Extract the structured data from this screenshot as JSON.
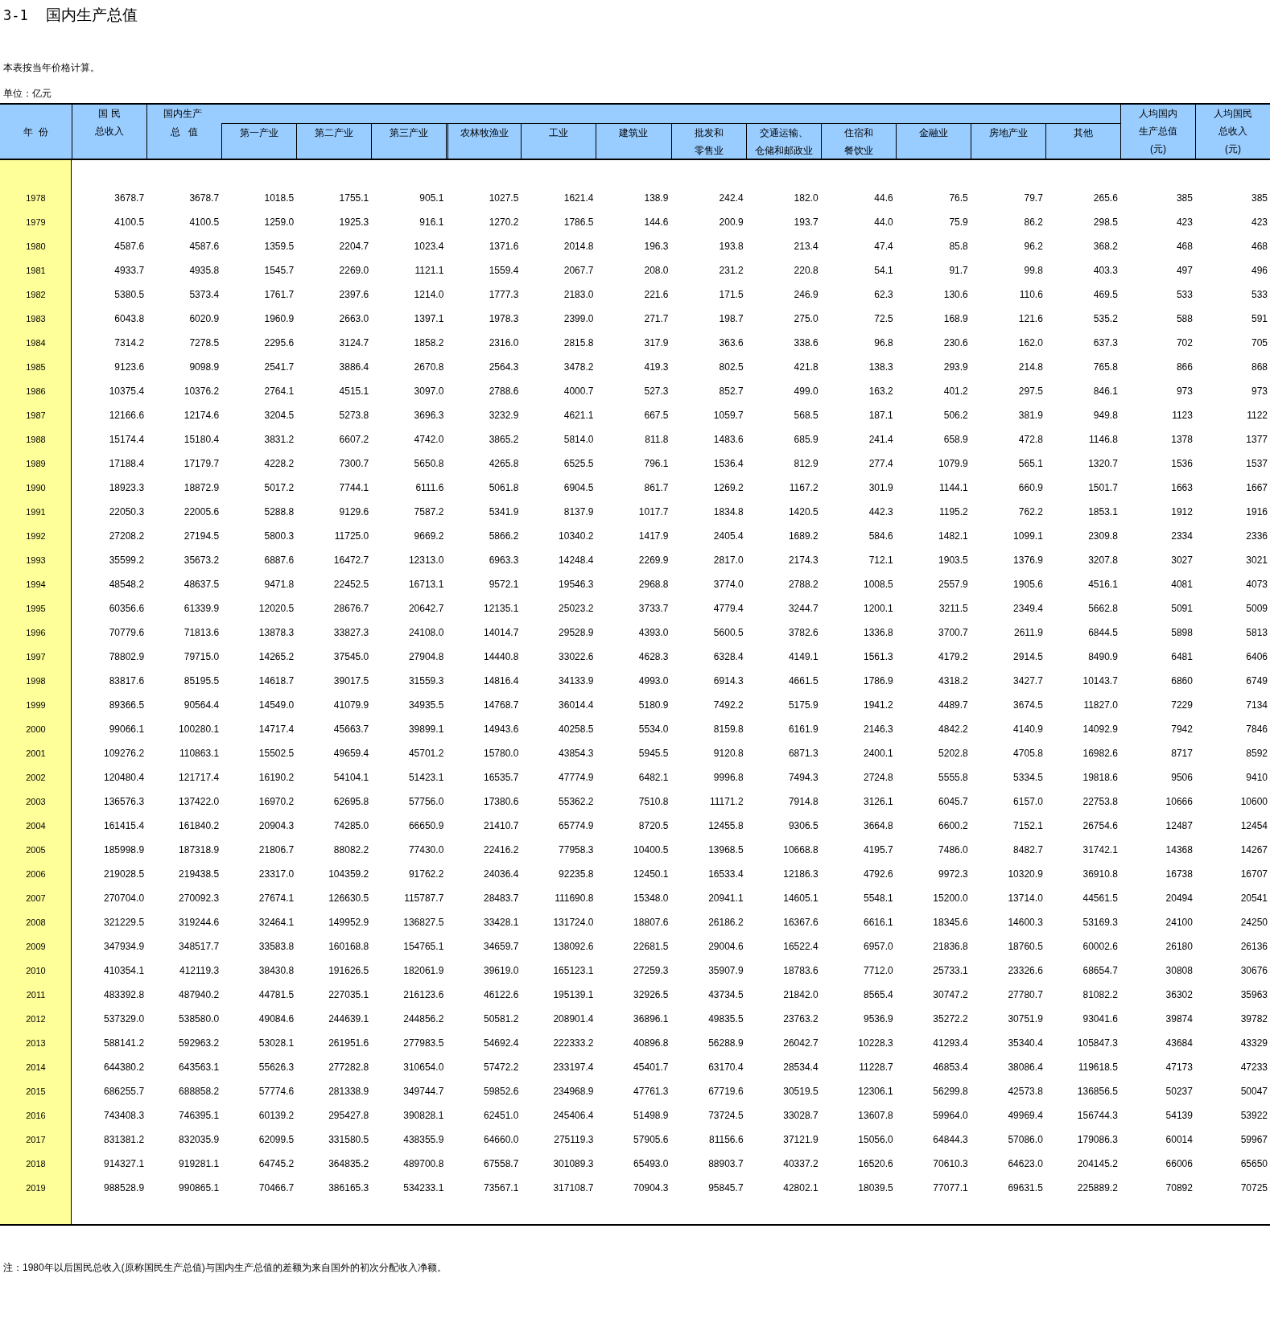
{
  "title": {
    "number": "3-1",
    "text": "国内生产总值"
  },
  "note": "本表按当年价格计算。",
  "unit": "单位：亿元",
  "header": {
    "year": "年  份",
    "gni": [
      "国 民",
      "总收入"
    ],
    "group": "国内生产",
    "gdp": "总   值",
    "subs": [
      [
        "第一产业"
      ],
      [
        "第二产业"
      ],
      [
        "第三产业"
      ],
      [
        "农林牧渔业"
      ],
      [
        "工业"
      ],
      [
        "建筑业"
      ],
      [
        "批发和",
        "零售业"
      ],
      [
        "交通运输、",
        "仓储和邮政业"
      ],
      [
        "住宿和",
        "餐饮业"
      ],
      [
        "金融业"
      ],
      [
        "房地产业"
      ],
      [
        "其他"
      ]
    ],
    "per_capita": [
      [
        "人均国内",
        "生产总值",
        "(元)"
      ],
      [
        "人均国民",
        "总收入",
        "(元)"
      ]
    ]
  },
  "rows": [
    {
      "year": "1978",
      "values": [
        "3678.7",
        "3678.7",
        "1018.5",
        "1755.1",
        "905.1",
        "1027.5",
        "1621.4",
        "138.9",
        "242.4",
        "182.0",
        "44.6",
        "76.5",
        "79.7",
        "265.6",
        "385",
        "385"
      ]
    },
    {
      "year": "1979",
      "values": [
        "4100.5",
        "4100.5",
        "1259.0",
        "1925.3",
        "916.1",
        "1270.2",
        "1786.5",
        "144.6",
        "200.9",
        "193.7",
        "44.0",
        "75.9",
        "86.2",
        "298.5",
        "423",
        "423"
      ]
    },
    {
      "year": "1980",
      "values": [
        "4587.6",
        "4587.6",
        "1359.5",
        "2204.7",
        "1023.4",
        "1371.6",
        "2014.8",
        "196.3",
        "193.8",
        "213.4",
        "47.4",
        "85.8",
        "96.2",
        "368.2",
        "468",
        "468"
      ]
    },
    {
      "year": "1981",
      "values": [
        "4933.7",
        "4935.8",
        "1545.7",
        "2269.0",
        "1121.1",
        "1559.4",
        "2067.7",
        "208.0",
        "231.2",
        "220.8",
        "54.1",
        "91.7",
        "99.8",
        "403.3",
        "497",
        "496"
      ]
    },
    {
      "year": "1982",
      "values": [
        "5380.5",
        "5373.4",
        "1761.7",
        "2397.6",
        "1214.0",
        "1777.3",
        "2183.0",
        "221.6",
        "171.5",
        "246.9",
        "62.3",
        "130.6",
        "110.6",
        "469.5",
        "533",
        "533"
      ]
    },
    {
      "year": "1983",
      "values": [
        "6043.8",
        "6020.9",
        "1960.9",
        "2663.0",
        "1397.1",
        "1978.3",
        "2399.0",
        "271.7",
        "198.7",
        "275.0",
        "72.5",
        "168.9",
        "121.6",
        "535.2",
        "588",
        "591"
      ]
    },
    {
      "year": "1984",
      "values": [
        "7314.2",
        "7278.5",
        "2295.6",
        "3124.7",
        "1858.2",
        "2316.0",
        "2815.8",
        "317.9",
        "363.6",
        "338.6",
        "96.8",
        "230.6",
        "162.0",
        "637.3",
        "702",
        "705"
      ]
    },
    {
      "year": "1985",
      "values": [
        "9123.6",
        "9098.9",
        "2541.7",
        "3886.4",
        "2670.8",
        "2564.3",
        "3478.2",
        "419.3",
        "802.5",
        "421.8",
        "138.3",
        "293.9",
        "214.8",
        "765.8",
        "866",
        "868"
      ]
    },
    {
      "year": "1986",
      "values": [
        "10375.4",
        "10376.2",
        "2764.1",
        "4515.1",
        "3097.0",
        "2788.6",
        "4000.7",
        "527.3",
        "852.7",
        "499.0",
        "163.2",
        "401.2",
        "297.5",
        "846.1",
        "973",
        "973"
      ]
    },
    {
      "year": "1987",
      "values": [
        "12166.6",
        "12174.6",
        "3204.5",
        "5273.8",
        "3696.3",
        "3232.9",
        "4621.1",
        "667.5",
        "1059.7",
        "568.5",
        "187.1",
        "506.2",
        "381.9",
        "949.8",
        "1123",
        "1122"
      ]
    },
    {
      "year": "1988",
      "values": [
        "15174.4",
        "15180.4",
        "3831.2",
        "6607.2",
        "4742.0",
        "3865.2",
        "5814.0",
        "811.8",
        "1483.6",
        "685.9",
        "241.4",
        "658.9",
        "472.8",
        "1146.8",
        "1378",
        "1377"
      ]
    },
    {
      "year": "1989",
      "values": [
        "17188.4",
        "17179.7",
        "4228.2",
        "7300.7",
        "5650.8",
        "4265.8",
        "6525.5",
        "796.1",
        "1536.4",
        "812.9",
        "277.4",
        "1079.9",
        "565.1",
        "1320.7",
        "1536",
        "1537"
      ]
    },
    {
      "year": "1990",
      "values": [
        "18923.3",
        "18872.9",
        "5017.2",
        "7744.1",
        "6111.6",
        "5061.8",
        "6904.5",
        "861.7",
        "1269.2",
        "1167.2",
        "301.9",
        "1144.1",
        "660.9",
        "1501.7",
        "1663",
        "1667"
      ]
    },
    {
      "year": "1991",
      "values": [
        "22050.3",
        "22005.6",
        "5288.8",
        "9129.6",
        "7587.2",
        "5341.9",
        "8137.9",
        "1017.7",
        "1834.8",
        "1420.5",
        "442.3",
        "1195.2",
        "762.2",
        "1853.1",
        "1912",
        "1916"
      ]
    },
    {
      "year": "1992",
      "values": [
        "27208.2",
        "27194.5",
        "5800.3",
        "11725.0",
        "9669.2",
        "5866.2",
        "10340.2",
        "1417.9",
        "2405.4",
        "1689.2",
        "584.6",
        "1482.1",
        "1099.1",
        "2309.8",
        "2334",
        "2336"
      ]
    },
    {
      "year": "1993",
      "values": [
        "35599.2",
        "35673.2",
        "6887.6",
        "16472.7",
        "12313.0",
        "6963.3",
        "14248.4",
        "2269.9",
        "2817.0",
        "2174.3",
        "712.1",
        "1903.5",
        "1376.9",
        "3207.8",
        "3027",
        "3021"
      ]
    },
    {
      "year": "1994",
      "values": [
        "48548.2",
        "48637.5",
        "9471.8",
        "22452.5",
        "16713.1",
        "9572.1",
        "19546.3",
        "2968.8",
        "3774.0",
        "2788.2",
        "1008.5",
        "2557.9",
        "1905.6",
        "4516.1",
        "4081",
        "4073"
      ]
    },
    {
      "year": "1995",
      "values": [
        "60356.6",
        "61339.9",
        "12020.5",
        "28676.7",
        "20642.7",
        "12135.1",
        "25023.2",
        "3733.7",
        "4779.4",
        "3244.7",
        "1200.1",
        "3211.5",
        "2349.4",
        "5662.8",
        "5091",
        "5009"
      ]
    },
    {
      "year": "1996",
      "values": [
        "70779.6",
        "71813.6",
        "13878.3",
        "33827.3",
        "24108.0",
        "14014.7",
        "29528.9",
        "4393.0",
        "5600.5",
        "3782.6",
        "1336.8",
        "3700.7",
        "2611.9",
        "6844.5",
        "5898",
        "5813"
      ]
    },
    {
      "year": "1997",
      "values": [
        "78802.9",
        "79715.0",
        "14265.2",
        "37545.0",
        "27904.8",
        "14440.8",
        "33022.6",
        "4628.3",
        "6328.4",
        "4149.1",
        "1561.3",
        "4179.2",
        "2914.5",
        "8490.9",
        "6481",
        "6406"
      ]
    },
    {
      "year": "1998",
      "values": [
        "83817.6",
        "85195.5",
        "14618.7",
        "39017.5",
        "31559.3",
        "14816.4",
        "34133.9",
        "4993.0",
        "6914.3",
        "4661.5",
        "1786.9",
        "4318.2",
        "3427.7",
        "10143.7",
        "6860",
        "6749"
      ]
    },
    {
      "year": "1999",
      "values": [
        "89366.5",
        "90564.4",
        "14549.0",
        "41079.9",
        "34935.5",
        "14768.7",
        "36014.4",
        "5180.9",
        "7492.2",
        "5175.9",
        "1941.2",
        "4489.7",
        "3674.5",
        "11827.0",
        "7229",
        "7134"
      ]
    },
    {
      "year": "2000",
      "values": [
        "99066.1",
        "100280.1",
        "14717.4",
        "45663.7",
        "39899.1",
        "14943.6",
        "40258.5",
        "5534.0",
        "8159.8",
        "6161.9",
        "2146.3",
        "4842.2",
        "4140.9",
        "14092.9",
        "7942",
        "7846"
      ]
    },
    {
      "year": "2001",
      "values": [
        "109276.2",
        "110863.1",
        "15502.5",
        "49659.4",
        "45701.2",
        "15780.0",
        "43854.3",
        "5945.5",
        "9120.8",
        "6871.3",
        "2400.1",
        "5202.8",
        "4705.8",
        "16982.6",
        "8717",
        "8592"
      ]
    },
    {
      "year": "2002",
      "values": [
        "120480.4",
        "121717.4",
        "16190.2",
        "54104.1",
        "51423.1",
        "16535.7",
        "47774.9",
        "6482.1",
        "9996.8",
        "7494.3",
        "2724.8",
        "5555.8",
        "5334.5",
        "19818.6",
        "9506",
        "9410"
      ]
    },
    {
      "year": "2003",
      "values": [
        "136576.3",
        "137422.0",
        "16970.2",
        "62695.8",
        "57756.0",
        "17380.6",
        "55362.2",
        "7510.8",
        "11171.2",
        "7914.8",
        "3126.1",
        "6045.7",
        "6157.0",
        "22753.8",
        "10666",
        "10600"
      ]
    },
    {
      "year": "2004",
      "values": [
        "161415.4",
        "161840.2",
        "20904.3",
        "74285.0",
        "66650.9",
        "21410.7",
        "65774.9",
        "8720.5",
        "12455.8",
        "9306.5",
        "3664.8",
        "6600.2",
        "7152.1",
        "26754.6",
        "12487",
        "12454"
      ]
    },
    {
      "year": "2005",
      "values": [
        "185998.9",
        "187318.9",
        "21806.7",
        "88082.2",
        "77430.0",
        "22416.2",
        "77958.3",
        "10400.5",
        "13968.5",
        "10668.8",
        "4195.7",
        "7486.0",
        "8482.7",
        "31742.1",
        "14368",
        "14267"
      ]
    },
    {
      "year": "2006",
      "values": [
        "219028.5",
        "219438.5",
        "23317.0",
        "104359.2",
        "91762.2",
        "24036.4",
        "92235.8",
        "12450.1",
        "16533.4",
        "12186.3",
        "4792.6",
        "9972.3",
        "10320.9",
        "36910.8",
        "16738",
        "16707"
      ]
    },
    {
      "year": "2007",
      "values": [
        "270704.0",
        "270092.3",
        "27674.1",
        "126630.5",
        "115787.7",
        "28483.7",
        "111690.8",
        "15348.0",
        "20941.1",
        "14605.1",
        "5548.1",
        "15200.0",
        "13714.0",
        "44561.5",
        "20494",
        "20541"
      ]
    },
    {
      "year": "2008",
      "values": [
        "321229.5",
        "319244.6",
        "32464.1",
        "149952.9",
        "136827.5",
        "33428.1",
        "131724.0",
        "18807.6",
        "26186.2",
        "16367.6",
        "6616.1",
        "18345.6",
        "14600.3",
        "53169.3",
        "24100",
        "24250"
      ]
    },
    {
      "year": "2009",
      "values": [
        "347934.9",
        "348517.7",
        "33583.8",
        "160168.8",
        "154765.1",
        "34659.7",
        "138092.6",
        "22681.5",
        "29004.6",
        "16522.4",
        "6957.0",
        "21836.8",
        "18760.5",
        "60002.6",
        "26180",
        "26136"
      ]
    },
    {
      "year": "2010",
      "values": [
        "410354.1",
        "412119.3",
        "38430.8",
        "191626.5",
        "182061.9",
        "39619.0",
        "165123.1",
        "27259.3",
        "35907.9",
        "18783.6",
        "7712.0",
        "25733.1",
        "23326.6",
        "68654.7",
        "30808",
        "30676"
      ]
    },
    {
      "year": "2011",
      "values": [
        "483392.8",
        "487940.2",
        "44781.5",
        "227035.1",
        "216123.6",
        "46122.6",
        "195139.1",
        "32926.5",
        "43734.5",
        "21842.0",
        "8565.4",
        "30747.2",
        "27780.7",
        "81082.2",
        "36302",
        "35963"
      ]
    },
    {
      "year": "2012",
      "values": [
        "537329.0",
        "538580.0",
        "49084.6",
        "244639.1",
        "244856.2",
        "50581.2",
        "208901.4",
        "36896.1",
        "49835.5",
        "23763.2",
        "9536.9",
        "35272.2",
        "30751.9",
        "93041.6",
        "39874",
        "39782"
      ]
    },
    {
      "year": "2013",
      "values": [
        "588141.2",
        "592963.2",
        "53028.1",
        "261951.6",
        "277983.5",
        "54692.4",
        "222333.2",
        "40896.8",
        "56288.9",
        "26042.7",
        "10228.3",
        "41293.4",
        "35340.4",
        "105847.3",
        "43684",
        "43329"
      ]
    },
    {
      "year": "2014",
      "values": [
        "644380.2",
        "643563.1",
        "55626.3",
        "277282.8",
        "310654.0",
        "57472.2",
        "233197.4",
        "45401.7",
        "63170.4",
        "28534.4",
        "11228.7",
        "46853.4",
        "38086.4",
        "119618.5",
        "47173",
        "47233"
      ]
    },
    {
      "year": "2015",
      "values": [
        "686255.7",
        "688858.2",
        "57774.6",
        "281338.9",
        "349744.7",
        "59852.6",
        "234968.9",
        "47761.3",
        "67719.6",
        "30519.5",
        "12306.1",
        "56299.8",
        "42573.8",
        "136856.5",
        "50237",
        "50047"
      ]
    },
    {
      "year": "2016",
      "values": [
        "743408.3",
        "746395.1",
        "60139.2",
        "295427.8",
        "390828.1",
        "62451.0",
        "245406.4",
        "51498.9",
        "73724.5",
        "33028.7",
        "13607.8",
        "59964.0",
        "49969.4",
        "156744.3",
        "54139",
        "53922"
      ]
    },
    {
      "year": "2017",
      "values": [
        "831381.2",
        "832035.9",
        "62099.5",
        "331580.5",
        "438355.9",
        "64660.0",
        "275119.3",
        "57905.6",
        "81156.6",
        "37121.9",
        "15056.0",
        "64844.3",
        "57086.0",
        "179086.3",
        "60014",
        "59967"
      ]
    },
    {
      "year": "2018",
      "values": [
        "914327.1",
        "919281.1",
        "64745.2",
        "364835.2",
        "489700.8",
        "67558.7",
        "301089.3",
        "65493.0",
        "88903.7",
        "40337.2",
        "16520.6",
        "70610.3",
        "64623.0",
        "204145.2",
        "66006",
        "65650"
      ]
    },
    {
      "year": "2019",
      "values": [
        "988528.9",
        "990865.1",
        "70466.7",
        "386165.3",
        "534233.1",
        "73567.1",
        "317108.7",
        "70904.3",
        "95845.7",
        "42802.1",
        "18039.5",
        "77077.1",
        "69631.5",
        "225889.2",
        "70892",
        "70725"
      ]
    }
  ],
  "footnote": "注：1980年以后国民总收入(原称国民生产总值)与国内生产总值的差额为来自国外的初次分配收入净额。"
}
